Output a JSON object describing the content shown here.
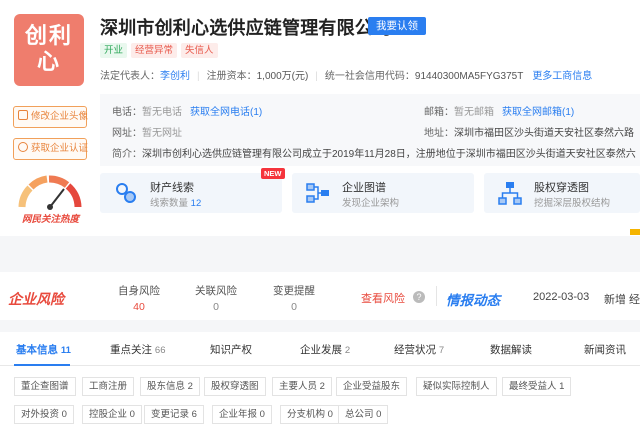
{
  "logo": {
    "line1": "创利",
    "line2": "心"
  },
  "sidebar": {
    "edit_avatar": "修改企业头像",
    "get_cert": "获取企业认证",
    "heat_label": "网民关注热度"
  },
  "company": {
    "name": "深圳市创利心选供应链管理有限公司",
    "claim_label": "我要认领",
    "tags": [
      "开业",
      "经营异常",
      "失信人"
    ]
  },
  "basic_info": {
    "legal_rep_label": "法定代表人：",
    "legal_rep": "李创利",
    "capital_label": "注册资本：",
    "capital": "1,000万(元)",
    "credit_label": "统一社会信用代码：",
    "credit_code": "91440300MA5FYG375T",
    "more_link": "更多工商信息"
  },
  "contact": {
    "phone_label": "电话：",
    "phone": "暂无电话",
    "phone_link": "获取全网电话(1)",
    "email_label": "邮箱：",
    "email": "暂无邮箱",
    "email_link": "获取全网邮箱(1)",
    "site_label": "网址：",
    "site": "暂无网址",
    "address_label": "地址：",
    "address": "深圳市福田区沙头街道天安社区泰然六路",
    "intro_label": "简介：",
    "intro": "深圳市创利心选供应链管理有限公司成立于2019年11月28日，注册地位于深圳市福田区沙头街道天安社区泰然六"
  },
  "cards": [
    {
      "title": "财产线索",
      "sub": "线索数量",
      "count": "12",
      "badge": "NEW"
    },
    {
      "title": "企业图谱",
      "sub": "发现企业架构"
    },
    {
      "title": "股权穿透图",
      "sub": "挖掘深层股权结构"
    }
  ],
  "risk": {
    "logo": "企业风险",
    "self_label": "自身风险",
    "self_value": "40",
    "related_label": "关联风险",
    "related_value": "0",
    "change_label": "变更提醒",
    "change_value": "0",
    "view_label": "查看风险"
  },
  "intel": {
    "logo": "情报动态",
    "date": "2022-03-03",
    "text": "新增 经"
  },
  "tabs": [
    {
      "label": "基本信息",
      "count": "11"
    },
    {
      "label": "重点关注",
      "count": "66"
    },
    {
      "label": "知识产权",
      "count": ""
    },
    {
      "label": "企业发展",
      "count": "2"
    },
    {
      "label": "经营状况",
      "count": "7"
    },
    {
      "label": "数据解读",
      "count": ""
    },
    {
      "label": "新闻资讯",
      "count": ""
    }
  ],
  "chips_row1": [
    "董企查图谱",
    "工商注册",
    "股东信息 2",
    "股权穿透图",
    "主要人员 2",
    "企业受益股东",
    "疑似实际控制人",
    "最终受益人 1"
  ],
  "chips_row2": [
    "对外投资 0",
    "控股企业 0",
    "变更记录 6",
    "企业年报 0",
    "分支机构 0",
    "总公司 0"
  ],
  "colors": {
    "accent": "#2a7ef0",
    "logo_bg": "#ef7d6d",
    "risk_red": "#e84a3d",
    "warn_orange": "#e8843c"
  }
}
